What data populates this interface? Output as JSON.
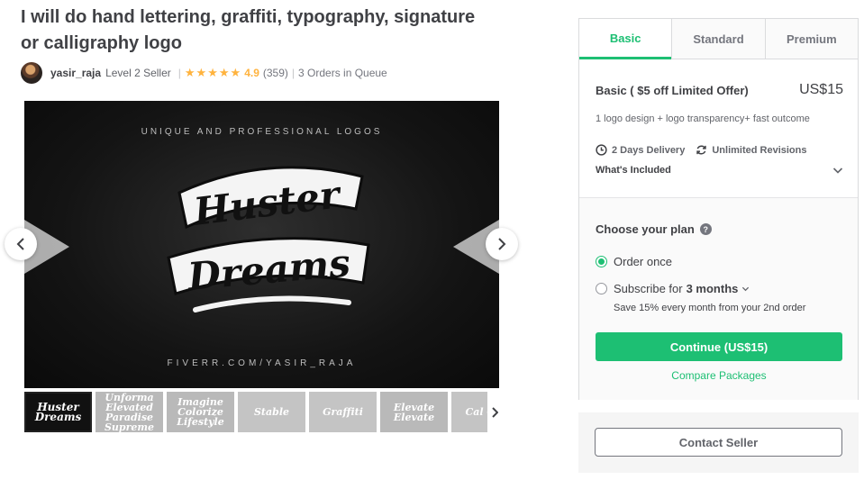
{
  "gig": {
    "title": "I will do hand lettering, graffiti, typography, signature or calligraphy logo"
  },
  "seller": {
    "name": "yasir_raja",
    "level": "Level 2 Seller",
    "stars": "★★★★★",
    "rating": "4.9",
    "reviews": "(359)",
    "separator": "|",
    "queue": "3 Orders in Queue"
  },
  "gallery": {
    "top_text": "UNIQUE AND PROFESSIONAL LOGOS",
    "logo_line1": "Huster",
    "logo_line2": "Dreams",
    "bottom_text": "FIVERR.COM/YASIR_RAJA",
    "thumbnails": [
      {
        "text": "Huster Dreams"
      },
      {
        "text": "Unforma Elevated Paradise Supreme"
      },
      {
        "text": "Imagine Colorize Lifestyle"
      },
      {
        "text": "Stable"
      },
      {
        "text": "Graffiti"
      },
      {
        "text": "Elevate Elevate"
      },
      {
        "text": "Cal Cal"
      }
    ]
  },
  "package": {
    "tabs": [
      "Basic",
      "Standard",
      "Premium"
    ],
    "active_tab": "Basic",
    "name": "Basic ( $5 off Limited Offer)",
    "price": "US$15",
    "description": "1 logo design + logo transparency+ fast outcome",
    "delivery": "2 Days Delivery",
    "revisions": "Unlimited Revisions",
    "included_label": "What's Included",
    "choose_plan": "Choose your plan",
    "help_glyph": "?",
    "order_once": "Order once",
    "subscribe_prefix": "Subscribe for",
    "subscribe_period": "3 months",
    "save_note": "Save 15% every month from your 2nd order",
    "continue_label": "Continue (US$15)",
    "compare_label": "Compare Packages"
  },
  "contact": {
    "label": "Contact Seller"
  },
  "colors": {
    "accent": "#1dbf73",
    "star": "#ffb33e",
    "text": "#404145"
  }
}
